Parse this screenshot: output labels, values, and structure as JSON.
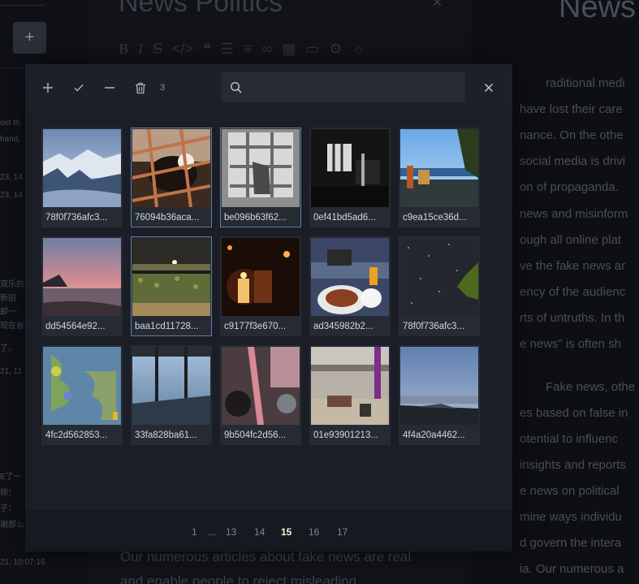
{
  "background": {
    "left_panel": {
      "add_label": "+",
      "fragments": [
        "ost th",
        "hand,",
        "23, 14",
        "23, 14",
        "双乐的",
        "新招",
        "即一",
        "现在省",
        "了。",
        "21, 11",
        "E了一",
        "称：",
        "子：",
        "谢那么",
        "21, 10:07:16"
      ]
    },
    "editor": {
      "title": "News Politics",
      "close_label": "×",
      "footer_lines": [
        "Our numerous articles about fake news are real",
        "and enable people to reject misleading"
      ]
    },
    "preview": {
      "title": "News",
      "lines": [
        "raditional medi",
        "have lost their care",
        "nance. On the othe",
        "social media is drivi",
        "on of propaganda.",
        "news and misinform",
        "ough all online plat",
        "ve the fake news ar",
        "ency of the audienc",
        "rts of untruths. In th",
        "e news”  is often sh",
        "Fake news, othe",
        "es based on false in",
        "otential to influenc",
        "insights and reports",
        "e news on political",
        "mine ways individu",
        "d govern the intera",
        "ia. Our numerous a"
      ]
    }
  },
  "modal": {
    "toolbar": {
      "add_icon": "plus-icon",
      "check_icon": "check-icon",
      "remove_icon": "minus-icon",
      "delete_icon": "trash-icon",
      "selected_count": "3"
    },
    "search": {
      "placeholder": "",
      "value": ""
    },
    "close_icon": "close-icon",
    "images": [
      {
        "name": "78f0f736afc3...",
        "selected": false,
        "scene": "mountain-lake"
      },
      {
        "name": "76094b36aca...",
        "selected": true,
        "scene": "cat-cage"
      },
      {
        "name": "be096b63f62...",
        "selected": true,
        "scene": "window-light"
      },
      {
        "name": "0ef41bd5ad6...",
        "selected": false,
        "scene": "dark-room"
      },
      {
        "name": "c9ea15ce36d...",
        "selected": false,
        "scene": "beach-table"
      },
      {
        "name": "dd54564e92...",
        "selected": false,
        "scene": "sunset-coast"
      },
      {
        "name": "baa1cd11728...",
        "selected": true,
        "scene": "night-seaweed"
      },
      {
        "name": "c9177f3e670...",
        "selected": false,
        "scene": "candle-night"
      },
      {
        "name": "ad345982b2...",
        "selected": false,
        "scene": "food-plate"
      },
      {
        "name": "78f0f736afc3...",
        "selected": false,
        "scene": "night-sky"
      },
      {
        "name": "4fc2d562853...",
        "selected": false,
        "scene": "weather-map"
      },
      {
        "name": "33fa828ba61...",
        "selected": false,
        "scene": "boat-window"
      },
      {
        "name": "9b504fc2d56...",
        "selected": false,
        "scene": "tuktuk"
      },
      {
        "name": "01e93901213...",
        "selected": false,
        "scene": "beach-tent"
      },
      {
        "name": "4f4a20a4462...",
        "selected": false,
        "scene": "beach-dusk"
      }
    ],
    "pagination": {
      "items": [
        "1",
        "...",
        "13",
        "14",
        "15",
        "16",
        "17"
      ],
      "current": "15"
    }
  },
  "colors": {
    "modal_bg": "#1b1e26",
    "selected_border": "#5d7fa8",
    "current_page": "#f3f1d4"
  }
}
